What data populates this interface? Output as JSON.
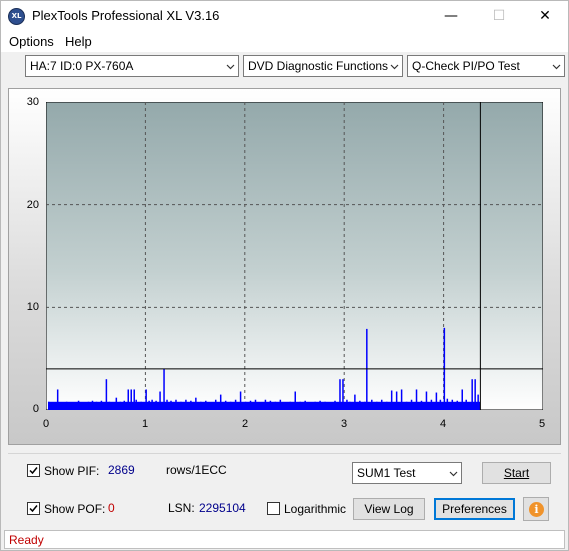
{
  "window": {
    "title": "PlexTools Professional XL V3.16",
    "icon_text": "XL"
  },
  "menu": {
    "options": "Options",
    "help": "Help"
  },
  "toolbar": {
    "drive": "HA:7 ID:0  PX-760A",
    "function": "DVD Diagnostic Functions",
    "test": "Q-Check PI/PO Test"
  },
  "chart_data": {
    "type": "bar",
    "y_ticks": [
      "30",
      "20",
      "10",
      "0"
    ],
    "x_ticks": [
      "0",
      "1",
      "2",
      "3",
      "4",
      "5"
    ],
    "xlim": [
      0,
      5
    ],
    "ylim": [
      0,
      30
    ],
    "threshold": 4,
    "end_marker_x": 4.37,
    "grid": true,
    "series": [
      {
        "color": "#0000ff",
        "values": [
          [
            0.02,
            0.8
          ],
          [
            0.08,
            0.5
          ],
          [
            0.11,
            2
          ],
          [
            0.14,
            0.7
          ],
          [
            0.2,
            0.8
          ],
          [
            0.27,
            0.6
          ],
          [
            0.32,
            0.9
          ],
          [
            0.38,
            0.7
          ],
          [
            0.42,
            0.8
          ],
          [
            0.46,
            0.9
          ],
          [
            0.5,
            0.8
          ],
          [
            0.55,
            0.9
          ],
          [
            0.6,
            3
          ],
          [
            0.63,
            0.8
          ],
          [
            0.7,
            1.2
          ],
          [
            0.74,
            0.8
          ],
          [
            0.78,
            0.9
          ],
          [
            0.82,
            2
          ],
          [
            0.85,
            2
          ],
          [
            0.88,
            2
          ],
          [
            0.9,
            1
          ],
          [
            0.95,
            0.8
          ],
          [
            1.0,
            2
          ],
          [
            1.03,
            0.9
          ],
          [
            1.06,
            1
          ],
          [
            1.1,
            0.9
          ],
          [
            1.14,
            1.8
          ],
          [
            1.18,
            4
          ],
          [
            1.21,
            1
          ],
          [
            1.25,
            0.9
          ],
          [
            1.3,
            1
          ],
          [
            1.35,
            0.8
          ],
          [
            1.4,
            1
          ],
          [
            1.45,
            0.9
          ],
          [
            1.5,
            1.2
          ],
          [
            1.55,
            0.8
          ],
          [
            1.6,
            0.9
          ],
          [
            1.65,
            0.7
          ],
          [
            1.7,
            1
          ],
          [
            1.75,
            1.5
          ],
          [
            1.8,
            0.9
          ],
          [
            1.85,
            0.8
          ],
          [
            1.9,
            1
          ],
          [
            1.95,
            1.8
          ],
          [
            2.0,
            0.8
          ],
          [
            2.05,
            0.9
          ],
          [
            2.1,
            1
          ],
          [
            2.15,
            0.7
          ],
          [
            2.2,
            1
          ],
          [
            2.25,
            0.9
          ],
          [
            2.3,
            0.8
          ],
          [
            2.35,
            1
          ],
          [
            2.4,
            0.7
          ],
          [
            2.45,
            0.8
          ],
          [
            2.5,
            1.8
          ],
          [
            2.55,
            0.8
          ],
          [
            2.6,
            0.9
          ],
          [
            2.65,
            0.7
          ],
          [
            2.7,
            0.8
          ],
          [
            2.75,
            0.9
          ],
          [
            2.8,
            0.8
          ],
          [
            2.85,
            0.7
          ],
          [
            2.9,
            0.9
          ],
          [
            2.95,
            3
          ],
          [
            2.98,
            3
          ],
          [
            3.02,
            1
          ],
          [
            3.05,
            0.8
          ],
          [
            3.1,
            1.5
          ],
          [
            3.15,
            0.9
          ],
          [
            3.2,
            0.8
          ],
          [
            3.22,
            7.9
          ],
          [
            3.27,
            1
          ],
          [
            3.32,
            0.8
          ],
          [
            3.37,
            1
          ],
          [
            3.42,
            0.8
          ],
          [
            3.47,
            1.9
          ],
          [
            3.52,
            1.8
          ],
          [
            3.57,
            2
          ],
          [
            3.62,
            0.8
          ],
          [
            3.67,
            1
          ],
          [
            3.72,
            2
          ],
          [
            3.77,
            0.9
          ],
          [
            3.82,
            1.8
          ],
          [
            3.87,
            1
          ],
          [
            3.92,
            1.7
          ],
          [
            3.96,
            1
          ],
          [
            4.0,
            8
          ],
          [
            4.03,
            1.1
          ],
          [
            4.08,
            1
          ],
          [
            4.13,
            0.9
          ],
          [
            4.18,
            2
          ],
          [
            4.22,
            1
          ],
          [
            4.28,
            3
          ],
          [
            4.31,
            3
          ],
          [
            4.34,
            1.5
          ]
        ]
      }
    ]
  },
  "controls": {
    "show_pif_label": "Show PIF:",
    "pif_value": "2869",
    "pif_unit": "rows/1ECC",
    "show_pof_label": "Show POF:",
    "pof_value": "0",
    "lsn_label": "LSN:",
    "lsn_value": "2295104",
    "logarithmic_label": "Logarithmic",
    "sum_select": "SUM1 Test",
    "start_label": "Start",
    "viewlog_label": "View Log",
    "preferences_label": "Preferences",
    "info_icon_text": "i"
  },
  "status": {
    "text": "Ready",
    "color": "#c00000"
  },
  "colors": {
    "plot_top": "#94a9ab",
    "plot_bottom": "#ffffff",
    "bars": "#0000ff"
  }
}
